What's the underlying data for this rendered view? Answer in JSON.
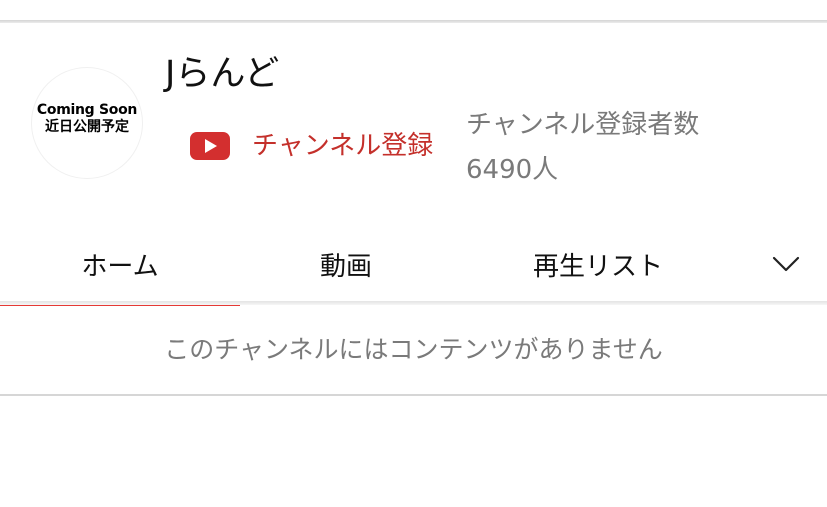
{
  "channel": {
    "name": "Jらんど",
    "avatar": {
      "line1": "Coming Soon",
      "line2": "近日公開予定"
    },
    "subscribe_label": "チャンネル登録",
    "subscriber_label": "チャンネル登録者数",
    "subscriber_count": "6490人"
  },
  "tabs": [
    {
      "label": "ホーム",
      "active": true
    },
    {
      "label": "動画",
      "active": false
    },
    {
      "label": "再生リスト",
      "active": false
    }
  ],
  "more_tabs_icon": "chevron-down-icon",
  "empty_message": "このチャンネルにはコンテンツがありません",
  "colors": {
    "accent": "#e53935",
    "subscribe_text": "#c4302b",
    "youtube_red": "#d32f2f",
    "muted_text": "#7a7a7a"
  }
}
